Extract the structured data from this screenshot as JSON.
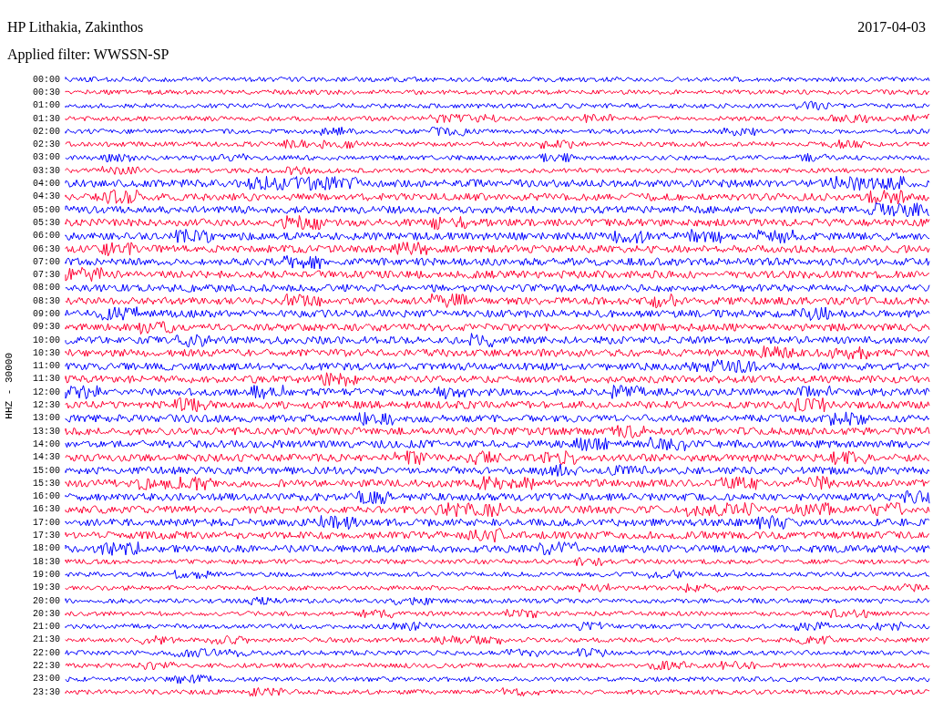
{
  "header": {
    "station": "HP Lithakia, Zakinthos",
    "date": "2017-04-03",
    "filter": "Applied filter: WWSSN-SP"
  },
  "axis_label": "HHZ - 30000",
  "traces": [
    {
      "time": "00:00",
      "color": "#0000ff"
    },
    {
      "time": "00:30",
      "color": "#ff0033"
    },
    {
      "time": "01:00",
      "color": "#0000ff"
    },
    {
      "time": "01:30",
      "color": "#ff0033"
    },
    {
      "time": "02:00",
      "color": "#0000ff"
    },
    {
      "time": "02:30",
      "color": "#ff0033"
    },
    {
      "time": "03:00",
      "color": "#0000ff"
    },
    {
      "time": "03:30",
      "color": "#ff0033"
    },
    {
      "time": "04:00",
      "color": "#0000ff"
    },
    {
      "time": "04:30",
      "color": "#ff0033"
    },
    {
      "time": "05:00",
      "color": "#0000ff"
    },
    {
      "time": "05:30",
      "color": "#ff0033"
    },
    {
      "time": "06:00",
      "color": "#0000ff"
    },
    {
      "time": "06:30",
      "color": "#ff0033"
    },
    {
      "time": "07:00",
      "color": "#0000ff"
    },
    {
      "time": "07:30",
      "color": "#ff0033"
    },
    {
      "time": "08:00",
      "color": "#0000ff"
    },
    {
      "time": "08:30",
      "color": "#ff0033"
    },
    {
      "time": "09:00",
      "color": "#0000ff"
    },
    {
      "time": "09:30",
      "color": "#ff0033"
    },
    {
      "time": "10:00",
      "color": "#0000ff"
    },
    {
      "time": "10:30",
      "color": "#ff0033"
    },
    {
      "time": "11:00",
      "color": "#0000ff"
    },
    {
      "time": "11:30",
      "color": "#ff0033"
    },
    {
      "time": "12:00",
      "color": "#0000ff"
    },
    {
      "time": "12:30",
      "color": "#ff0033"
    },
    {
      "time": "13:00",
      "color": "#0000ff"
    },
    {
      "time": "13:30",
      "color": "#ff0033"
    },
    {
      "time": "14:00",
      "color": "#0000ff"
    },
    {
      "time": "14:30",
      "color": "#ff0033"
    },
    {
      "time": "15:00",
      "color": "#0000ff"
    },
    {
      "time": "15:30",
      "color": "#ff0033"
    },
    {
      "time": "16:00",
      "color": "#0000ff"
    },
    {
      "time": "16:30",
      "color": "#ff0033"
    },
    {
      "time": "17:00",
      "color": "#0000ff"
    },
    {
      "time": "17:30",
      "color": "#ff0033"
    },
    {
      "time": "18:00",
      "color": "#0000ff"
    },
    {
      "time": "18:30",
      "color": "#ff0033"
    },
    {
      "time": "19:00",
      "color": "#0000ff"
    },
    {
      "time": "19:30",
      "color": "#ff0033"
    },
    {
      "time": "20:00",
      "color": "#0000ff"
    },
    {
      "time": "20:30",
      "color": "#ff0033"
    },
    {
      "time": "21:00",
      "color": "#0000ff"
    },
    {
      "time": "21:30",
      "color": "#ff0033"
    },
    {
      "time": "22:00",
      "color": "#0000ff"
    },
    {
      "time": "22:30",
      "color": "#ff0033"
    },
    {
      "time": "23:00",
      "color": "#0000ff"
    },
    {
      "time": "23:30",
      "color": "#ff0033"
    }
  ]
}
